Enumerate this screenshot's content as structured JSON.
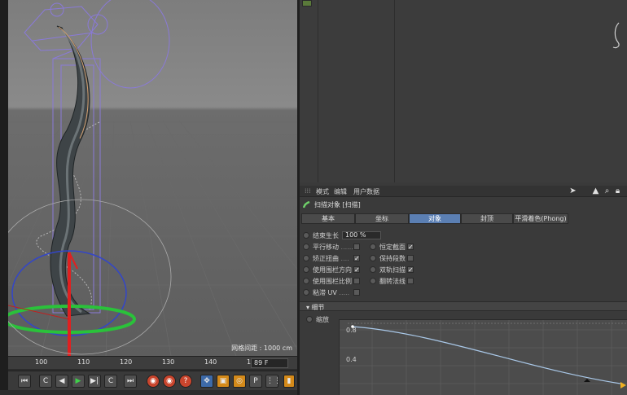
{
  "viewport": {
    "grid_label": "网格间距 : 1000 cm"
  },
  "timeline": {
    "ticks": [
      "100",
      "110",
      "120",
      "130",
      "140",
      "15"
    ],
    "frame": "89 F"
  },
  "transport": {
    "buttons": [
      "⏮",
      "C",
      "◀",
      "▶",
      "▶|",
      "C",
      "⏭"
    ]
  },
  "attribute_manager": {
    "menu": [
      "模式",
      "编辑",
      "用户数据"
    ],
    "object_title": "扫描对象 [扫描]",
    "tabs": [
      "基本",
      "坐标",
      "对象",
      "封顶",
      "平滑着色(Phong)"
    ],
    "active_tab": "对象",
    "props": {
      "end_growth": {
        "label": "结束生长",
        "value": "100 %"
      },
      "parallel_move": {
        "label": "平行移动",
        "dots": "......",
        "checked": false
      },
      "constant_section": {
        "label": "恒定截面",
        "checked": true
      },
      "banking": {
        "label": "矫正扭曲",
        "dots": "....",
        "checked": true
      },
      "keep_segments": {
        "label": "保持段数",
        "checked": false
      },
      "use_rail_direction": {
        "label": "使用围栏方向",
        "checked": true
      },
      "double_rail": {
        "label": "双轨扫描",
        "checked": true
      },
      "use_rail_scale": {
        "label": "使用围栏比例",
        "checked": false
      },
      "flip_normals": {
        "label": "翻转法线",
        "checked": false
      },
      "stick_uv": {
        "label": "粘滞 UV",
        "dots": ".....",
        "checked": false
      }
    },
    "details_label": "▾ 细节",
    "scale_label": "缩放",
    "graph_ticks": [
      "0.8",
      "0.4"
    ]
  },
  "colors": {
    "accent": "#5b7fb3",
    "panel": "#3a3a3a",
    "viewport": "#6d6d6d"
  }
}
